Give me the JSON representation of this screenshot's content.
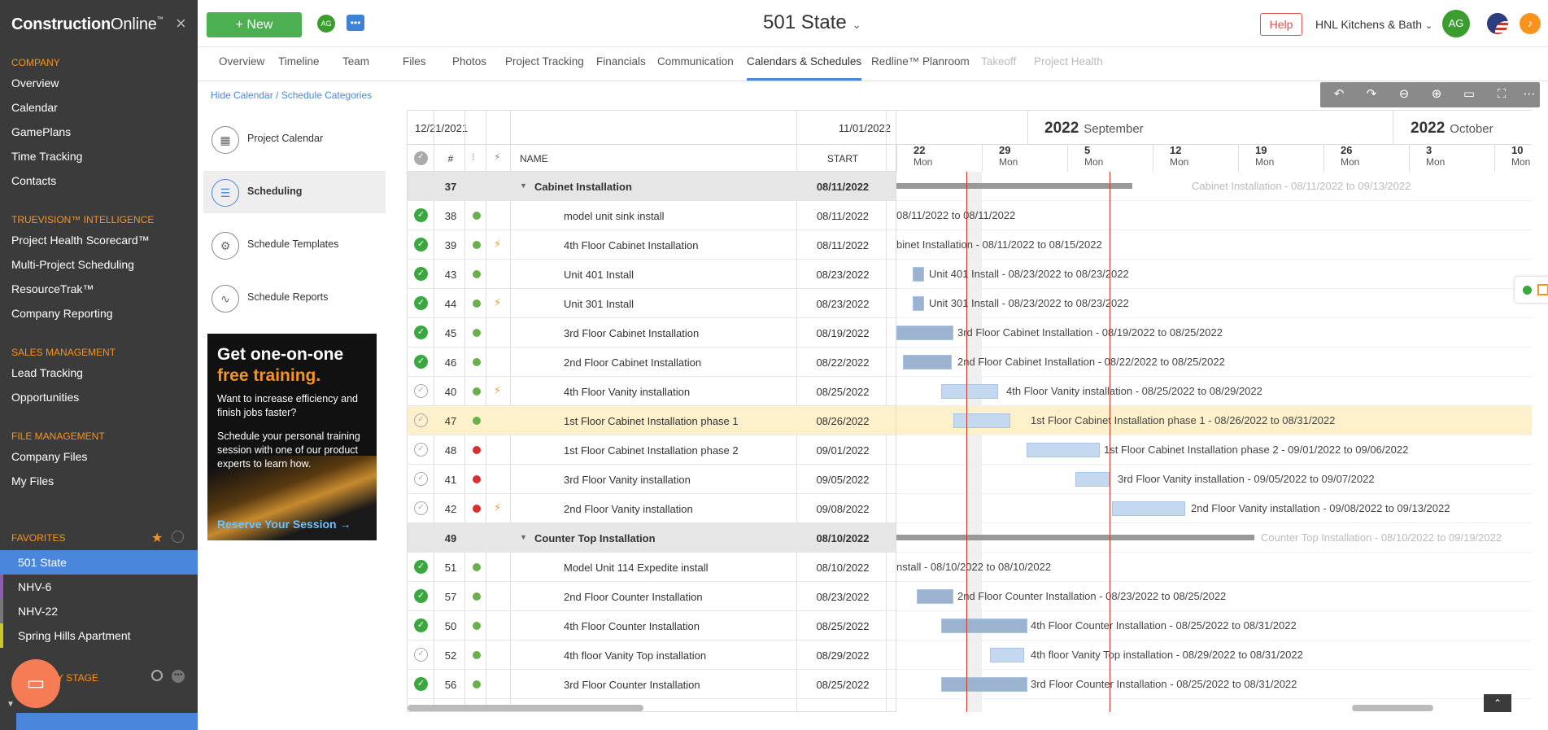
{
  "sidebar": {
    "brand_main": "Construction",
    "brand_sub": "Online",
    "brand_tm": "™",
    "close_glyph": "×",
    "sections": [
      {
        "title": "COMPANY",
        "items": [
          "Overview",
          "Calendar",
          "GamePlans",
          "Time Tracking",
          "Contacts"
        ]
      },
      {
        "title": "TRUEVISION™ INTELLIGENCE",
        "items": [
          "Project Health Scorecard™",
          "Multi-Project Scheduling",
          "ResourceTrak™",
          "Company Reporting"
        ]
      },
      {
        "title": "SALES MANAGEMENT",
        "items": [
          "Lead Tracking",
          "Opportunities"
        ]
      },
      {
        "title": "FILE MANAGEMENT",
        "items": [
          "Company Files",
          "My Files"
        ]
      }
    ],
    "favorites_title": "FAVORITES",
    "favorites": [
      {
        "label": "501 State",
        "color": "#4a87dc"
      },
      {
        "label": "NHV-6",
        "color": "#8e5bb5"
      },
      {
        "label": "NHV-22",
        "color": "#777777"
      },
      {
        "label": "Spring Hills Apartment",
        "color": "#c8c82a"
      }
    ],
    "stage_title": "Y STAGE"
  },
  "topbar": {
    "new_label": "+  New",
    "avatar_small": "AG",
    "project_title": "501 State",
    "help_label": "Help",
    "company_name": "HNL Kitchens & Bath",
    "avatar_large": "AG"
  },
  "tabs": [
    "Overview",
    "Timeline",
    "Team",
    "Files",
    "Photos",
    "Project Tracking",
    "Financials",
    "Communication",
    "Calendars & Schedules",
    "Redline™ Planroom",
    "Takeoff",
    "Project Health"
  ],
  "active_tab": "Calendars & Schedules",
  "hide_calendar_link": "Hide Calendar / Schedule Categories",
  "calendar_nav": [
    {
      "label": "Project Calendar",
      "icon": "calendar-icon"
    },
    {
      "label": "Scheduling",
      "icon": "scheduling-icon"
    },
    {
      "label": "Schedule Templates",
      "icon": "template-icon"
    },
    {
      "label": "Schedule Reports",
      "icon": "report-icon"
    }
  ],
  "promo": {
    "headline": "Get one-on-one",
    "highlight": "free training.",
    "line1": "Want to increase efficiency and finish jobs faster?",
    "line2": "Schedule your personal training session with one of our product experts to learn how.",
    "cta": "Reserve Your Session →"
  },
  "grid": {
    "start_date": "12/21/2021",
    "end_date": "11/01/2022",
    "col_num": "#",
    "col_name": "NAME",
    "col_start": "START"
  },
  "timeline": {
    "year1": "2022",
    "month1": "September",
    "year2": "2022",
    "month2": "October",
    "weeks": [
      {
        "day": "22",
        "dow": "Mon"
      },
      {
        "day": "29",
        "dow": "Mon"
      },
      {
        "day": "5",
        "dow": "Mon"
      },
      {
        "day": "12",
        "dow": "Mon"
      },
      {
        "day": "19",
        "dow": "Mon"
      },
      {
        "day": "26",
        "dow": "Mon"
      },
      {
        "day": "3",
        "dow": "Mon"
      },
      {
        "day": "10",
        "dow": "Mon"
      }
    ]
  },
  "rows": [
    {
      "num": "37",
      "name": "Cabinet Installation",
      "start": "08/11/2022",
      "group": true,
      "gantt": "Cabinet Installation - 08/11/2022 to 09/13/2022"
    },
    {
      "num": "38",
      "name": "model unit sink install",
      "start": "08/11/2022",
      "done": true,
      "dot": "#6ab04c",
      "gantt": "08/11/2022 to 08/11/2022"
    },
    {
      "num": "39",
      "name": "4th Floor Cabinet Installation",
      "start": "08/11/2022",
      "done": true,
      "dot": "#6ab04c",
      "flag": true,
      "gantt": "binet Installation - 08/11/2022 to 08/15/2022"
    },
    {
      "num": "43",
      "name": "Unit 401 Install",
      "start": "08/23/2022",
      "done": true,
      "dot": "#6ab04c",
      "gantt": "Unit 401 Install - 08/23/2022 to 08/23/2022"
    },
    {
      "num": "44",
      "name": "Unit 301 Install",
      "start": "08/23/2022",
      "done": true,
      "dot": "#6ab04c",
      "flag": true,
      "gantt": "Unit 301 Install - 08/23/2022 to 08/23/2022"
    },
    {
      "num": "45",
      "name": "3rd Floor Cabinet Installation",
      "start": "08/19/2022",
      "done": true,
      "dot": "#6ab04c",
      "gantt": "3rd Floor Cabinet Installation - 08/19/2022 to 08/25/2022"
    },
    {
      "num": "46",
      "name": "2nd Floor Cabinet Installation",
      "start": "08/22/2022",
      "done": true,
      "dot": "#6ab04c",
      "gantt": "2nd Floor Cabinet Installation - 08/22/2022 to 08/25/2022"
    },
    {
      "num": "40",
      "name": "4th Floor Vanity installation",
      "start": "08/25/2022",
      "done": false,
      "dot": "#6ab04c",
      "flag": true,
      "gantt": "4th Floor Vanity installation - 08/25/2022 to 08/29/2022"
    },
    {
      "num": "47",
      "name": "1st Floor Cabinet Installation phase 1",
      "start": "08/26/2022",
      "done": false,
      "dot": "#6ab04c",
      "selected": true,
      "gantt": "1st Floor Cabinet Installation phase 1 - 08/26/2022 to 08/31/2022"
    },
    {
      "num": "48",
      "name": "1st Floor Cabinet Installation phase 2",
      "start": "09/01/2022",
      "done": false,
      "dot": "#d63031",
      "gantt": "1st Floor Cabinet Installation phase 2 - 09/01/2022 to 09/06/2022"
    },
    {
      "num": "41",
      "name": "3rd Floor Vanity installation",
      "start": "09/05/2022",
      "done": false,
      "dot": "#d63031",
      "gantt": "3rd Floor Vanity installation - 09/05/2022 to 09/07/2022"
    },
    {
      "num": "42",
      "name": "2nd Floor Vanity installation",
      "start": "09/08/2022",
      "done": false,
      "dot": "#d63031",
      "flag": true,
      "gantt": "2nd Floor Vanity installation - 09/08/2022 to 09/13/2022"
    },
    {
      "num": "49",
      "name": "Counter Top Installation",
      "start": "08/10/2022",
      "group": true,
      "gantt": "Counter Top Installation - 08/10/2022 to 09/19/2022"
    },
    {
      "num": "51",
      "name": "Model Unit 114 Expedite install",
      "start": "08/10/2022",
      "done": true,
      "dot": "#6ab04c",
      "gantt": "nstall - 08/10/2022 to 08/10/2022"
    },
    {
      "num": "57",
      "name": "2nd Floor Counter Installation",
      "start": "08/23/2022",
      "done": true,
      "dot": "#6ab04c",
      "gantt": "2nd Floor Counter Installation - 08/23/2022 to 08/25/2022"
    },
    {
      "num": "50",
      "name": "4th Floor Counter Installation",
      "start": "08/25/2022",
      "done": true,
      "dot": "#6ab04c",
      "gantt": "4th Floor Counter Installation - 08/25/2022 to 08/31/2022"
    },
    {
      "num": "52",
      "name": "4th floor Vanity Top installation",
      "start": "08/29/2022",
      "done": false,
      "dot": "#6ab04c",
      "gantt": "4th floor Vanity Top installation - 08/29/2022 to 08/31/2022"
    },
    {
      "num": "56",
      "name": "3rd Floor Counter Installation",
      "start": "08/25/2022",
      "done": true,
      "dot": "#6ab04c",
      "gantt": "3rd Floor Counter Installation - 08/25/2022 to 08/31/2022"
    }
  ]
}
